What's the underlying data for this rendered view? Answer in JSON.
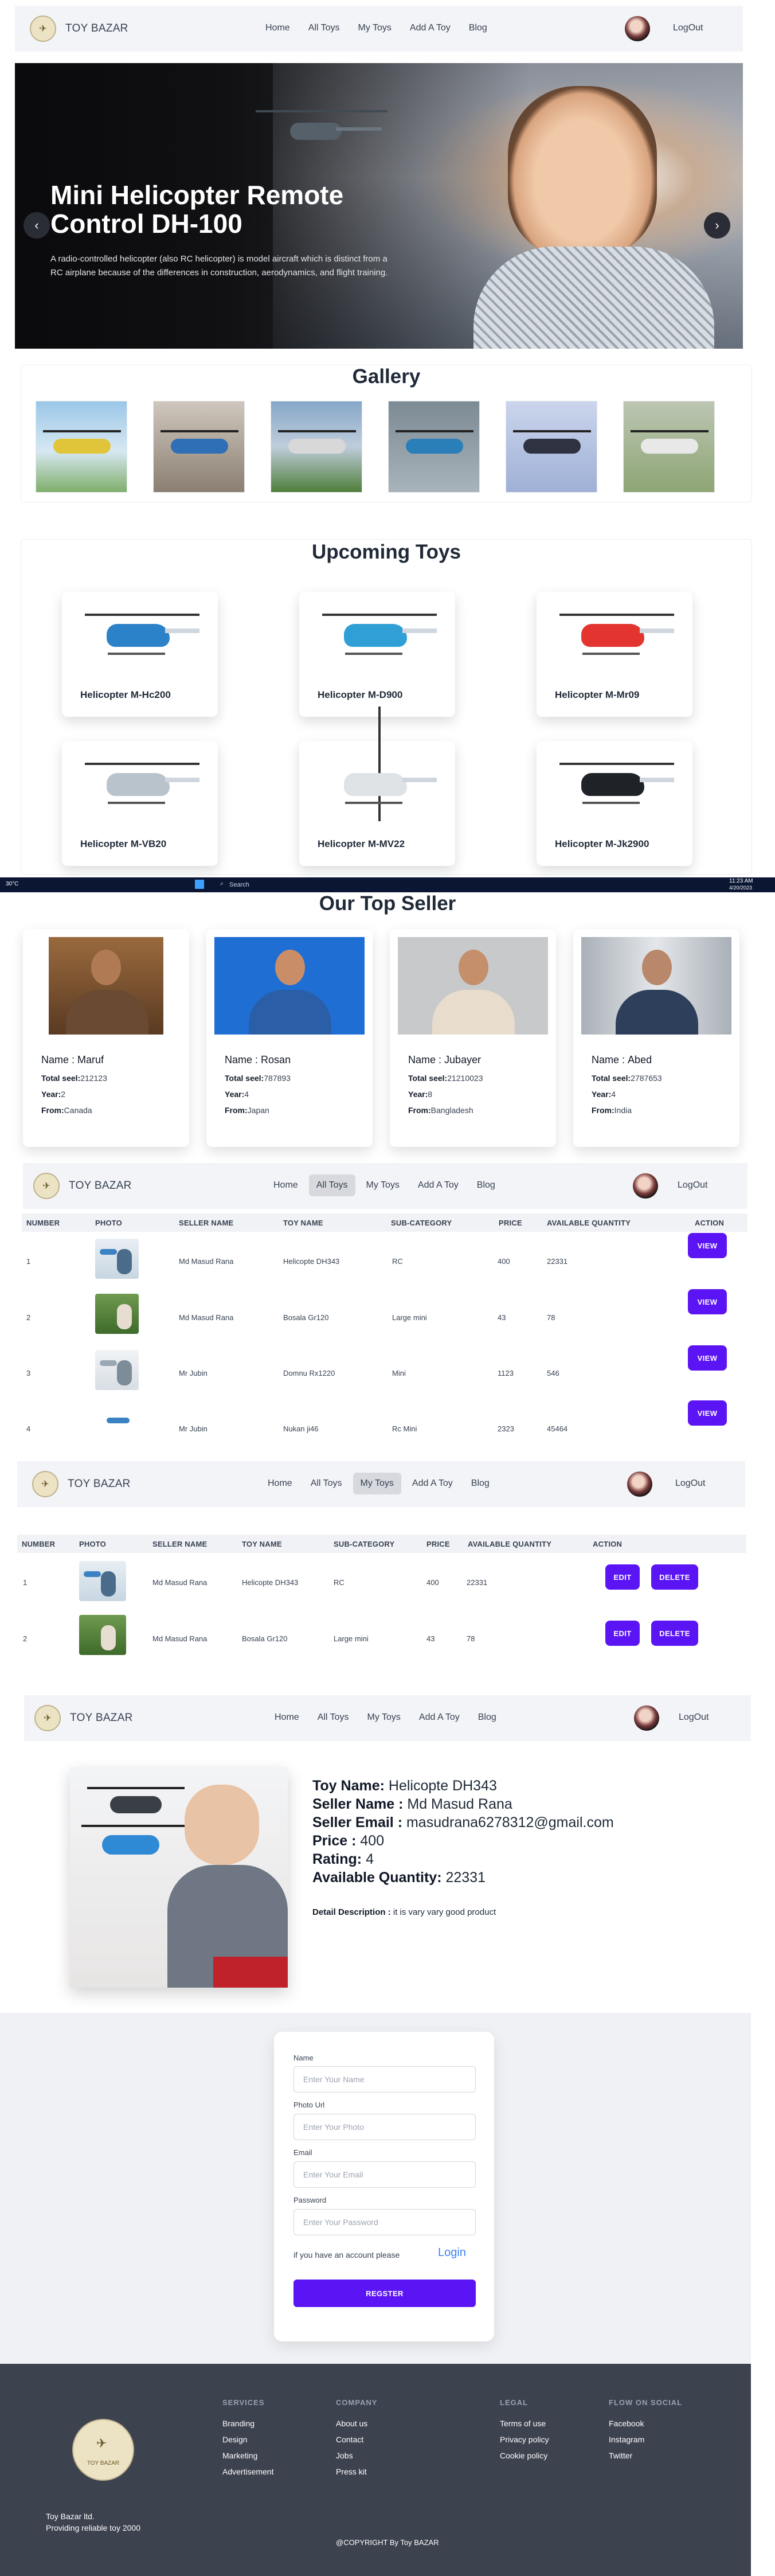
{
  "colors": {
    "accent": "#5b15f5",
    "navbar_bg": "#f3f4f8",
    "footer_bg": "#3d424f",
    "link": "#3b82f6"
  },
  "nav": {
    "logo_icon": "helicopter-logo-icon",
    "brand": "TOY BAZAR",
    "links": [
      "Home",
      "All Toys",
      "My Toys",
      "Add A Toy",
      "Blog"
    ],
    "logout": "LogOut"
  },
  "banner": {
    "title": "Mini Helicopter Remote Control DH-100",
    "text": "A radio-controlled helicopter (also RC helicopter) is model aircraft which is distinct from a RC airplane because of the differences in construction, aerodynamics, and flight training.",
    "prev_icon": "chevron-left-icon",
    "next_icon": "chevron-right-icon"
  },
  "gallery": {
    "title": "Gallery"
  },
  "upcoming": {
    "title": "Upcoming Toys",
    "toys": [
      "Helicopter M-Hc200",
      "Helicopter M-D900",
      "Helicopter M-Mr09",
      "Helicopter M-VB20",
      "Helicopter M-MV22",
      "Helicopter M-Jk2900"
    ]
  },
  "taskbar": {
    "temp": "30°C",
    "search": "Search",
    "time": "11:23 AM",
    "date": "4/20/2023"
  },
  "top_sellers": {
    "title": "Our Top Seller",
    "name_label": "Name :",
    "total_label": "Total seel:",
    "year_label": "Year:",
    "from_label": "From:",
    "sellers": [
      {
        "name": "Maruf",
        "total": "212123",
        "year": "2",
        "from": "Canada"
      },
      {
        "name": "Rosan",
        "total": "787893",
        "year": "4",
        "from": "Japan"
      },
      {
        "name": "Jubayer",
        "total": "21210023",
        "year": "8",
        "from": "Bangladesh"
      },
      {
        "name": "Abed",
        "total": "2787653",
        "year": "4",
        "from": "India"
      }
    ]
  },
  "all_toys_table": {
    "headers": [
      "NUMBER",
      "PHOTO",
      "SELLER NAME",
      "TOY NAME",
      "SUB-CATEGORY",
      "PRICE",
      "AVAILABLE QUANTITY",
      "ACTION"
    ],
    "button": "VIEW",
    "rows": [
      {
        "number": "1",
        "seller": "Md Masud Rana",
        "toy": "Helicopte DH343",
        "sub": "RC",
        "price": "400",
        "qty": "22331"
      },
      {
        "number": "2",
        "seller": "Md Masud Rana",
        "toy": "Bosala Gr120",
        "sub": "Large mini",
        "price": "43",
        "qty": "78"
      },
      {
        "number": "3",
        "seller": "Mr Jubin",
        "toy": "Domnu Rx1220",
        "sub": "Mini",
        "price": "1123",
        "qty": "546"
      },
      {
        "number": "4",
        "seller": "Mr Jubin",
        "toy": "Nukan ji46",
        "sub": "Rc Mini",
        "price": "2323",
        "qty": "45464"
      }
    ]
  },
  "my_toys_table": {
    "headers": [
      "NUMBER",
      "PHOTO",
      "SELLER NAME",
      "TOY NAME",
      "SUB-CATEGORY",
      "PRICE",
      "AVAILABLE QUANTITY",
      "ACTION"
    ],
    "edit": "EDIT",
    "delete": "DELETE",
    "rows": [
      {
        "number": "1",
        "seller": "Md Masud Rana",
        "toy": "Helicopte DH343",
        "sub": "RC",
        "price": "400",
        "qty": "22331"
      },
      {
        "number": "2",
        "seller": "Md Masud Rana",
        "toy": "Bosala Gr120",
        "sub": "Large mini",
        "price": "43",
        "qty": "78"
      }
    ]
  },
  "detail": {
    "toy_label": "Toy Name:",
    "toy": "Helicopte DH343",
    "seller_label": "Seller Name :",
    "seller": "Md Masud Rana",
    "email_label": "Seller Email :",
    "email": "masudrana6278312@gmail.com",
    "price_label": "Price :",
    "price": "400",
    "rating_label": "Rating:",
    "rating": "4",
    "qty_label": "Available Quantity:",
    "qty": "22331",
    "desc_label": "Detail Description :",
    "desc": "it is vary vary good product"
  },
  "register": {
    "name_label": "Name",
    "name_placeholder": "Enter Your Name",
    "photo_label": "Photo Url",
    "photo_placeholder": "Enter Your Photo",
    "email_label": "Email",
    "email_placeholder": "Enter Your Email",
    "password_label": "Password",
    "password_placeholder": "Enter Your Password",
    "account_text": "if you have an account please",
    "login": "Login",
    "button": "REGSTER"
  },
  "footer": {
    "brand": "TOY BAZAR",
    "company_name": "Toy Bazar ltd.",
    "tagline": "Providing reliable toy 2000",
    "copyright": "@COPYRIGHT By Toy BAZAR",
    "services": {
      "title": "SERVICES",
      "items": [
        "Branding",
        "Design",
        "Marketing",
        "Advertisement"
      ]
    },
    "company": {
      "title": "COMPANY",
      "items": [
        "About us",
        "Contact",
        "Jobs",
        "Press kit"
      ]
    },
    "legal": {
      "title": "LEGAL",
      "items": [
        "Terms of use",
        "Privacy policy",
        "Cookie policy"
      ]
    },
    "social": {
      "title": "FLOW ON SOCIAL",
      "items": [
        "Facebook",
        "Instagram",
        "Twitter"
      ]
    }
  }
}
